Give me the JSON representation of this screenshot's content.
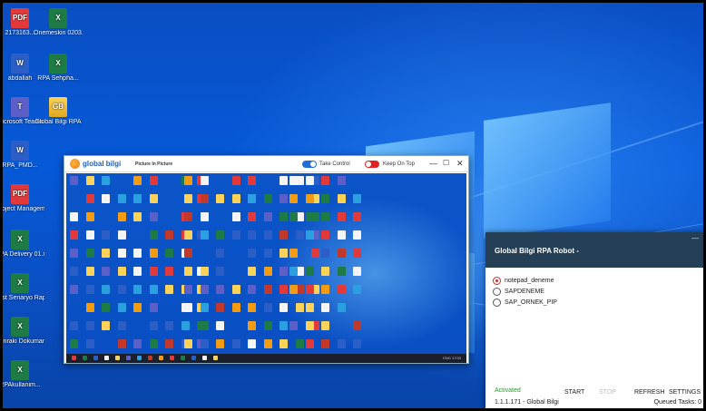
{
  "desktop": {
    "icons": [
      {
        "label": "2173163...",
        "kind": "pdf"
      },
      {
        "label": "Onemeskin 0203.xlsx",
        "kind": "xls"
      },
      {
        "label": "abdallah",
        "kind": "doc"
      },
      {
        "label": "RPA Sehpha...",
        "kind": "xls"
      },
      {
        "label": "Microsoft Teams",
        "kind": "teams"
      },
      {
        "label": "Global Bilgi RPA",
        "kind": "folder"
      },
      {
        "label": "RPA_PMD...",
        "kind": "doc"
      },
      {
        "label": "Project Management...",
        "kind": "pdf"
      },
      {
        "label": "RPA Delivery 01.xlsx",
        "kind": "xls"
      },
      {
        "label": "Test Senaryo Raporu.xlsx",
        "kind": "xls"
      },
      {
        "label": "Sonraki Dokuman...",
        "kind": "xls"
      },
      {
        "label": "RPAkullanim...",
        "kind": "xls"
      }
    ],
    "icon_texts": {
      "pdf": "PDF",
      "xls": "X",
      "doc": "W",
      "teams": "T",
      "folder": "GB"
    }
  },
  "pip_window": {
    "brand": "global bilgi",
    "subtitle": "Picture In Picture",
    "take_control_label": "Take Control",
    "take_control_on": true,
    "keep_on_top_label": "Keep On Top",
    "keep_on_top_on": false,
    "minimize": "—",
    "maximize": "☐",
    "close": "✕",
    "tray_text": "ENG 17:00"
  },
  "rpa_window": {
    "title": "Global Bilgi RPA Robot -",
    "minimize": "—",
    "processes": [
      {
        "label": "notepad_deneme",
        "selected": true
      },
      {
        "label": "SAPDENEME",
        "selected": false
      },
      {
        "label": "SAP_ORNEK_PIP",
        "selected": false
      }
    ],
    "status": "Activated",
    "buttons": {
      "start": "START",
      "stop": "STOP",
      "refresh": "REFRESH",
      "settings": "SETTINGS"
    },
    "version": "1.1.1.171 - Global Bilgi",
    "queued": "Queued Tasks: 0"
  },
  "colors": {
    "accent_blue": "#1f6fd6",
    "toggle_off_red": "#e02222",
    "rpa_title_bg": "#253f57",
    "status_green": "#2a9a2a"
  }
}
